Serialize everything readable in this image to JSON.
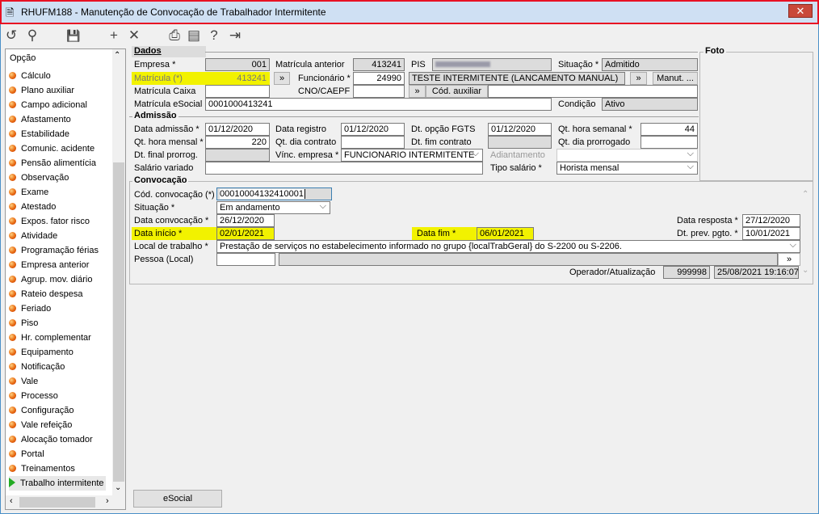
{
  "window": {
    "title": "RHUFM188 - Manutenção de Convocação de Trabalhador Intermitente",
    "close": "✕"
  },
  "toolbar": [
    {
      "icon": "undo-icon",
      "glyph": "↺"
    },
    {
      "icon": "search-icon",
      "glyph": "⚲"
    },
    {
      "icon": "save-icon",
      "glyph": "💾"
    },
    {
      "icon": "add-icon",
      "glyph": "+"
    },
    {
      "icon": "delete-icon",
      "glyph": "✕"
    },
    {
      "icon": "print-icon",
      "glyph": "⎙"
    },
    {
      "icon": "calendar-icon",
      "glyph": "▤"
    },
    {
      "icon": "help-icon",
      "glyph": "?"
    },
    {
      "icon": "exit-icon",
      "glyph": "⇥"
    }
  ],
  "sidebar": {
    "header": "Opção",
    "items": [
      "Cálculo",
      "Plano auxiliar",
      "Campo adicional",
      "Afastamento",
      "Estabilidade",
      "Comunic. acidente",
      "Pensão alimentícia",
      "Observação",
      "Exame",
      "Atestado",
      "Expos. fator risco",
      "Atividade",
      "Programação férias",
      "Empresa anterior",
      "Agrup. mov. diário",
      "Rateio despesa",
      "Feriado",
      "Piso",
      "Hr. complementar",
      "Equipamento",
      "Notificação",
      "Vale",
      "Processo",
      "Configuração",
      "Vale refeição",
      "Alocação tomador",
      "Portal",
      "Treinamentos",
      "Trabalho intermitente"
    ],
    "selected": "Trabalho intermitente"
  },
  "dados": {
    "title": "Dados",
    "empresa_label": "Empresa *",
    "empresa": "001",
    "mat_ant_label": "Matrícula anterior",
    "mat_ant": "413241",
    "pis_label": "PIS",
    "situacao_label": "Situação *",
    "situacao": "Admitido",
    "matricula_label": "Matrícula (*)",
    "matricula": "413241",
    "func_label": "Funcionário *",
    "func": "24990",
    "func_nome": "TESTE INTERMITENTE (LANCAMENTO MANUAL)",
    "manut": "Manut. ...",
    "mat_caixa_label": "Matrícula Caixa",
    "cno_label": "CNO/CAEPF",
    "cod_aux": "Cód. auxiliar",
    "mat_esocial_label": "Matrícula eSocial",
    "mat_esocial": "0001000413241",
    "condicao_label": "Condição",
    "condicao": "Ativo",
    "more": "»"
  },
  "admissao": {
    "title": "Admissão",
    "data_adm_label": "Data admissão *",
    "data_adm": "01/12/2020",
    "data_reg_label": "Data registro",
    "data_reg": "01/12/2020",
    "fgts_label": "Dt. opção FGTS",
    "fgts": "01/12/2020",
    "qhs_label": "Qt. hora semanal *",
    "qhs": "44",
    "qhm_label": "Qt. hora mensal *",
    "qhm": "220",
    "qdc_label": "Qt. dia contrato",
    "dfc_label": "Dt. fim contrato",
    "qdp_label": "Qt. dia prorrogado",
    "dfp_label": "Dt. final prorrog.",
    "vinc_label": "Vínc. empresa *",
    "vinc": "FUNCIONARIO INTERMITENTE",
    "adiant_label": "Adiantamento",
    "sal_var_label": "Salário variado",
    "tipo_sal_label": "Tipo salário *",
    "tipo_sal": "Horista mensal"
  },
  "foto": {
    "title": "Foto"
  },
  "convocacao": {
    "title": "Convocação",
    "cod_label": "Cód. convocação (*)",
    "cod": "00010004132410001",
    "sit_label": "Situação *",
    "sit": "Em andamento",
    "dconv_label": "Data convocação *",
    "dconv": "26/12/2020",
    "dresp_label": "Data resposta *",
    "dresp": "27/12/2020",
    "dini_label": "Data início *",
    "dini": "02/01/2021",
    "dfim_label": "Data fim *",
    "dfim": "06/01/2021",
    "dprev_label": "Dt. prev. pgto. *",
    "dprev": "10/01/2021",
    "local_label": "Local de trabalho *",
    "local": "Prestação de serviços no estabelecimento informado no grupo {localTrabGeral} do S-2200 ou S-2206.",
    "pessoa_label": "Pessoa (Local)",
    "oper_label": "Operador/Atualização",
    "oper": "999998",
    "atualiz": "25/08/2021 19:16:07"
  },
  "footer": {
    "esocial": "eSocial"
  }
}
